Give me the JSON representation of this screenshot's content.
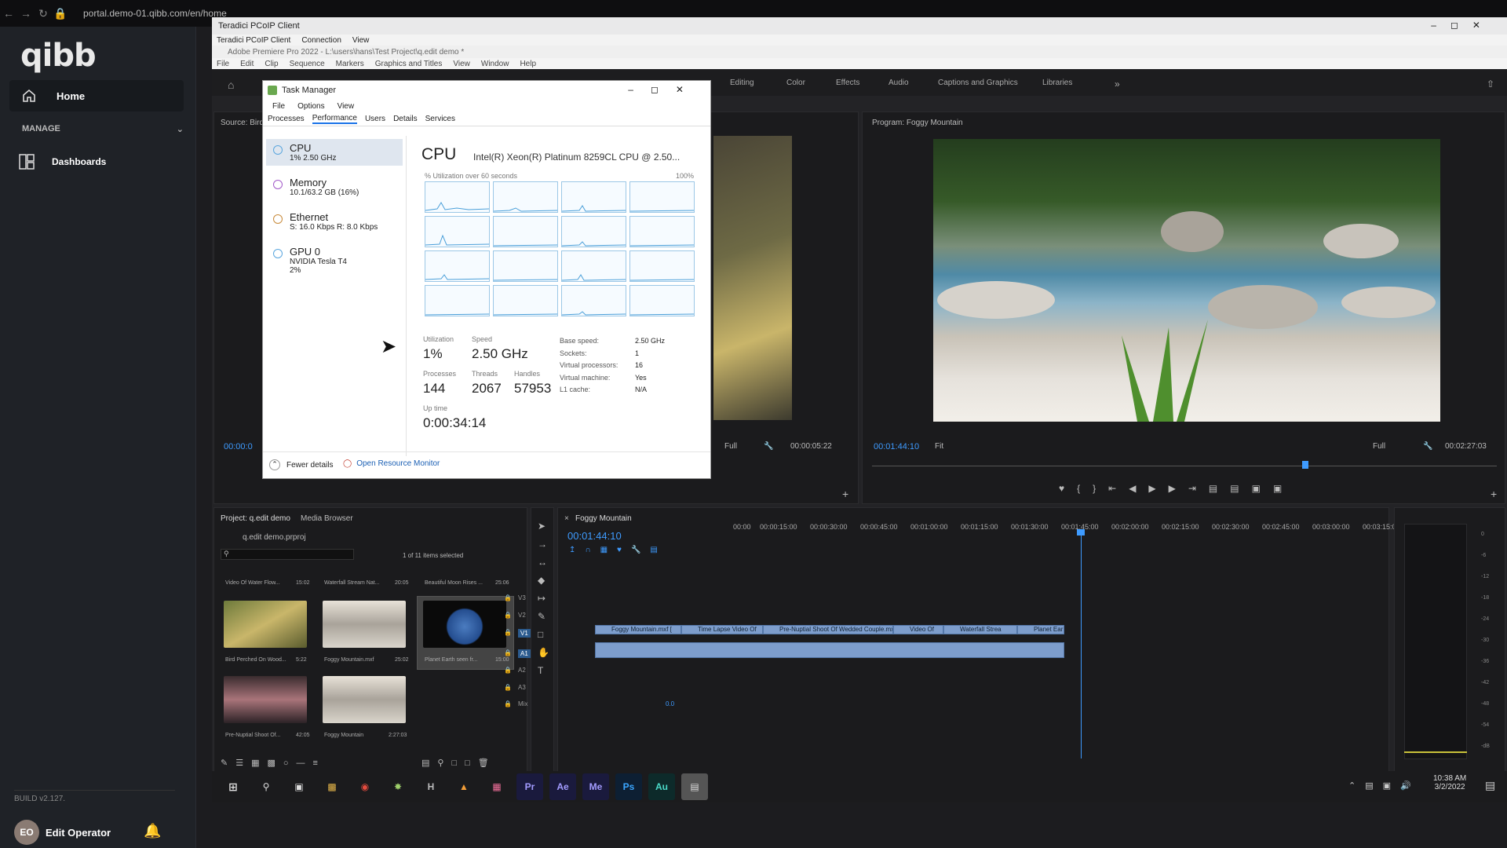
{
  "browser": {
    "url": "portal.demo-01.qibb.com/en/home"
  },
  "sidebar": {
    "logo": "qibb",
    "home_label": "Home",
    "manage_label": "MANAGE",
    "dashboards_label": "Dashboards",
    "build": "BUILD v2.127.",
    "user_initials": "EO",
    "user_name": "Edit Operator"
  },
  "pcoip": {
    "title": "Teradici PCoIP Client",
    "menu": [
      "Teradici PCoIP Client",
      "Connection",
      "View"
    ]
  },
  "premiere": {
    "title": "Adobe Premiere Pro 2022 - L:\\users\\hans\\Test Project\\q.edit demo *",
    "menu": [
      "File",
      "Edit",
      "Clip",
      "Sequence",
      "Markers",
      "Graphics and Titles",
      "View",
      "Window",
      "Help"
    ],
    "workspaces": [
      "Editing",
      "Color",
      "Effects",
      "Audio",
      "Captions and Graphics",
      "Libraries"
    ],
    "source_label": "Source: Bird",
    "source_tc_left": "00:00:0",
    "source_fit": "Full",
    "source_tc_right": "00:00:05:22",
    "program_label": "Program: Foggy Mountain",
    "program_tc_left": "00:01:44:10",
    "program_fit": "Fit",
    "program_quality": "Full",
    "program_tc_right": "00:02:27:03",
    "project_tab": "Project: q.edit demo",
    "media_browser_tab": "Media Browser",
    "project_file": "q.edit demo.prproj",
    "items_selected": "1 of 11 items selected",
    "bin_row_top": [
      {
        "name": "Video Of Water Flow...",
        "dur": "15:02"
      },
      {
        "name": "Waterfall Stream Nat...",
        "dur": "20:05"
      },
      {
        "name": "Beautiful Moon Rises ...",
        "dur": "25:06"
      }
    ],
    "bin_items": [
      {
        "name": "Bird Perched On Wood...",
        "dur": "5:22"
      },
      {
        "name": "Foggy Mountain.mxf",
        "dur": "25:02"
      },
      {
        "name": "Planet Earth seen fr...",
        "dur": "15:00"
      },
      {
        "name": "Pre-Nuptial Shoot Of...",
        "dur": "42:05"
      },
      {
        "name": "Foggy Mountain",
        "dur": "2:27:03"
      }
    ],
    "timeline_tab": "Foggy Mountain",
    "timeline_tc": "00:01:44:10",
    "ruler": [
      "00:00",
      "00:00:15:00",
      "00:00:30:00",
      "00:00:45:00",
      "00:01:00:00",
      "00:01:15:00",
      "00:01:30:00",
      "00:01:45:00",
      "00:02:00:00",
      "00:02:15:00",
      "00:02:30:00",
      "00:02:45:00",
      "00:03:00:00",
      "00:03:15:00"
    ],
    "clips": [
      "Foggy Mountain.mxf [",
      "Time Lapse Video Of",
      "Pre-Nuptial Shoot Of Wedded Couple.mxf [V",
      "Video Of",
      "Waterfall Strea",
      "Planet Ear"
    ],
    "tracks_video": [
      "V3",
      "V2",
      "V1"
    ],
    "tracks_audio": [
      "A1",
      "A2",
      "A3"
    ],
    "mix_label": "Mix",
    "mix_value": "0.0",
    "meter_scale": [
      "0",
      "-6",
      "-12",
      "-18",
      "-24",
      "-30",
      "-36",
      "-42",
      "-48",
      "-54",
      "-dB"
    ]
  },
  "taskmgr": {
    "title": "Task Manager",
    "menu": [
      "File",
      "Options",
      "View"
    ],
    "tabs": [
      "Processes",
      "Performance",
      "Users",
      "Details",
      "Services"
    ],
    "resources": [
      {
        "name": "CPU",
        "sub": "1% 2.50 GHz",
        "color": "#5aa6de"
      },
      {
        "name": "Memory",
        "sub": "10.1/63.2 GB (16%)",
        "color": "#a25ac9"
      },
      {
        "name": "Ethernet",
        "sub": "S: 16.0 Kbps R: 8.0 Kbps",
        "color": "#c88a3a"
      },
      {
        "name": "GPU 0",
        "sub": "NVIDIA Tesla T4",
        "sub2": "2%",
        "color": "#5aa6de"
      }
    ],
    "heading": "CPU",
    "cpu_model": "Intel(R) Xeon(R) Platinum 8259CL CPU @ 2.50...",
    "util_caption": "% Utilization over 60 seconds",
    "util_max": "100%",
    "utilization_label": "Utilization",
    "utilization": "1%",
    "speed_label": "Speed",
    "speed": "2.50 GHz",
    "processes_label": "Processes",
    "processes": "144",
    "threads_label": "Threads",
    "threads": "2067",
    "handles_label": "Handles",
    "handles": "57953",
    "uptime_label": "Up time",
    "uptime": "0:00:34:14",
    "details": [
      {
        "k": "Base speed:",
        "v": "2.50 GHz"
      },
      {
        "k": "Sockets:",
        "v": "1"
      },
      {
        "k": "Virtual processors:",
        "v": "16"
      },
      {
        "k": "Virtual machine:",
        "v": "Yes"
      },
      {
        "k": "L1 cache:",
        "v": "N/A"
      }
    ],
    "fewer_details": "Fewer details",
    "open_resource_monitor": "Open Resource Monitor"
  },
  "taskbar": {
    "apps": [
      "Pr",
      "Ae",
      "Me",
      "Ps",
      "Au"
    ],
    "time": "10:38 AM",
    "date": "3/2/2022"
  }
}
